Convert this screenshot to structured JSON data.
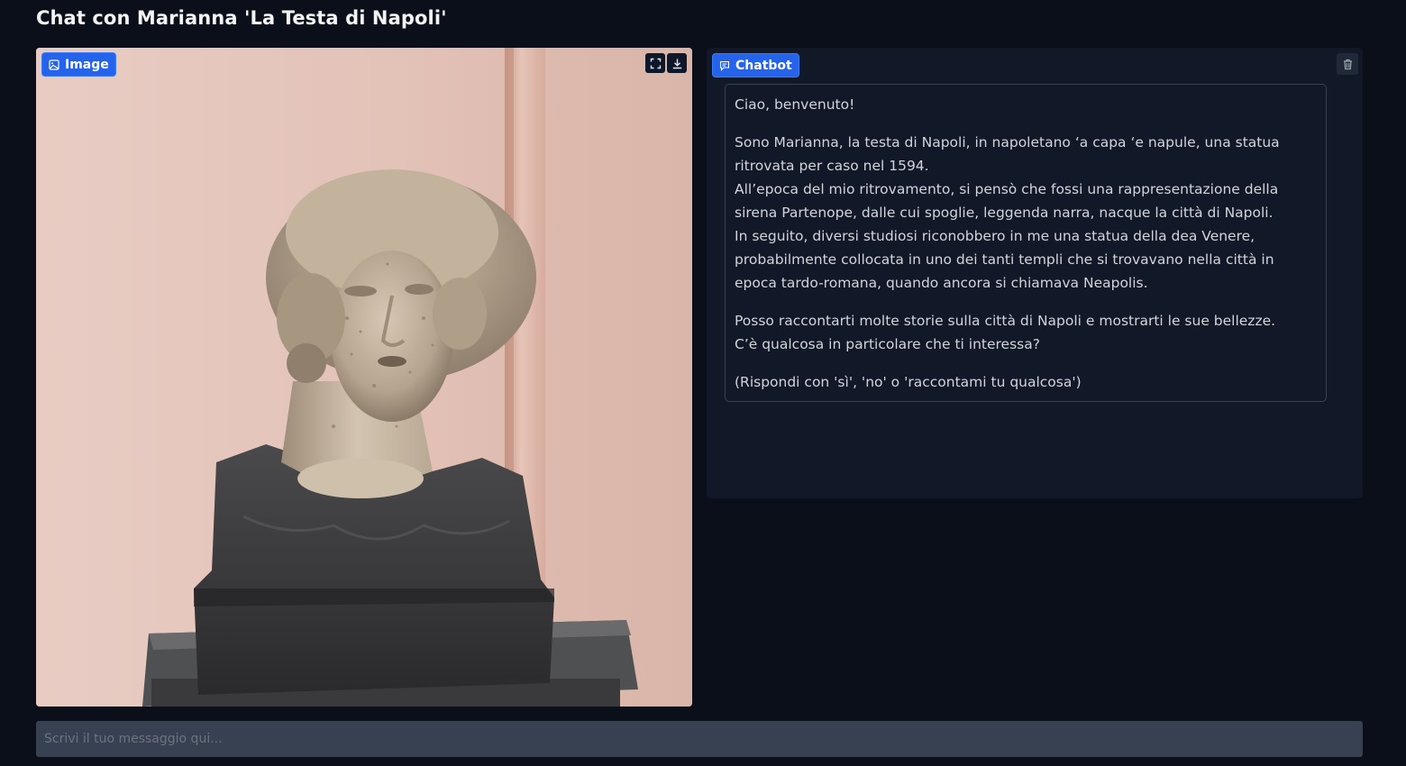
{
  "page": {
    "title": "Chat con Marianna 'La Testa di Napoli'"
  },
  "image_block": {
    "label": "Image",
    "icon": "image-icon",
    "actions": [
      "fullscreen-icon",
      "download-icon"
    ]
  },
  "chatbot_block": {
    "label": "Chatbot",
    "icon": "chat-icon",
    "clear_icon": "trash-icon",
    "messages": [
      {
        "role": "bot",
        "paragraphs": [
          [
            "Ciao, benvenuto!"
          ],
          [
            "Sono Marianna, la testa di Napoli, in napoletano ‘a capa ‘e napule, una statua",
            "ritrovata per caso nel 1594.",
            "All’epoca del mio ritrovamento, si pensò che fossi una rappresentazione della",
            "sirena Partenope, dalle cui spoglie, leggenda narra, nacque la città di Napoli.",
            "In seguito, diversi studiosi riconobbero in me una statua della dea Venere,",
            "probabilmente collocata in uno dei tanti templi che si trovavano nella città in",
            "epoca tardo-romana, quando ancora si chiamava Neapolis."
          ],
          [
            "Posso raccontarti molte storie sulla città di Napoli e mostrarti le sue bellezze.",
            "C’è qualcosa in particolare che ti interessa?"
          ],
          [
            "(Rispondi con 'sì', 'no' o 'raccontami tu qualcosa')"
          ]
        ]
      }
    ]
  },
  "input": {
    "placeholder": "Scrivi il tuo messaggio qui...",
    "value": ""
  },
  "colors": {
    "background": "#0b0f19",
    "panel": "#111827",
    "accent": "#2563eb",
    "input": "#374151"
  }
}
